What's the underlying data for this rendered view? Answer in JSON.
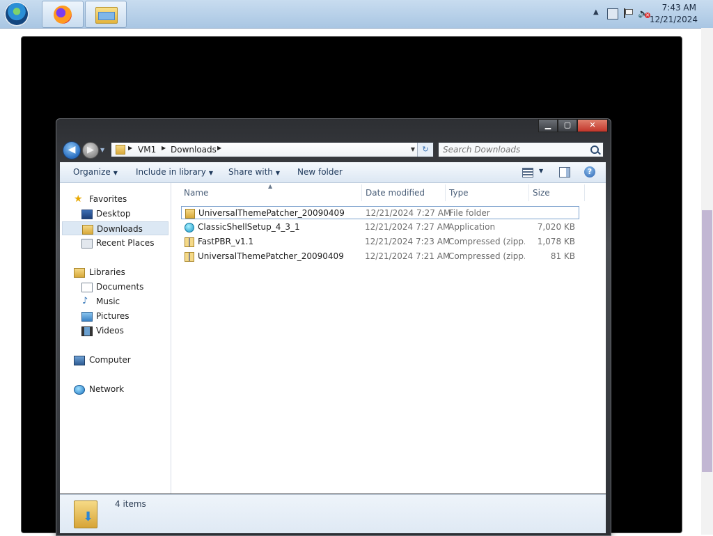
{
  "taskbar": {
    "clock_time": "7:43 AM",
    "clock_date": "12/21/2024"
  },
  "explorer": {
    "caption_buttons": {
      "minimize": "▁",
      "maximize": "▢",
      "close": "✕"
    },
    "address": {
      "crumbs": [
        "VM1",
        "Downloads"
      ]
    },
    "search": {
      "placeholder": "Search Downloads"
    },
    "commands": {
      "organize": "Organize",
      "include_in_library": "Include in library",
      "share_with": "Share with",
      "new_folder": "New folder"
    },
    "nav": {
      "favorites": "Favorites",
      "desktop": "Desktop",
      "downloads": "Downloads",
      "recent_places": "Recent Places",
      "libraries": "Libraries",
      "documents": "Documents",
      "music": "Music",
      "pictures": "Pictures",
      "videos": "Videos",
      "computer": "Computer",
      "network": "Network"
    },
    "columns": {
      "name": "Name",
      "date_modified": "Date modified",
      "type": "Type",
      "size": "Size"
    },
    "files": [
      {
        "name": "UniversalThemePatcher_20090409",
        "date": "12/21/2024 7:27 AM",
        "type": "File folder",
        "size": ""
      },
      {
        "name": "ClassicShellSetup_4_3_1",
        "date": "12/21/2024 7:27 AM",
        "type": "Application",
        "size": "7,020 KB"
      },
      {
        "name": "FastPBR_v1.1",
        "date": "12/21/2024 7:23 AM",
        "type": "Compressed (zipp...",
        "size": "1,078 KB"
      },
      {
        "name": "UniversalThemePatcher_20090409",
        "date": "12/21/2024 7:21 AM",
        "type": "Compressed (zipp...",
        "size": "81 KB"
      }
    ],
    "status": {
      "item_count": "4 items"
    }
  }
}
